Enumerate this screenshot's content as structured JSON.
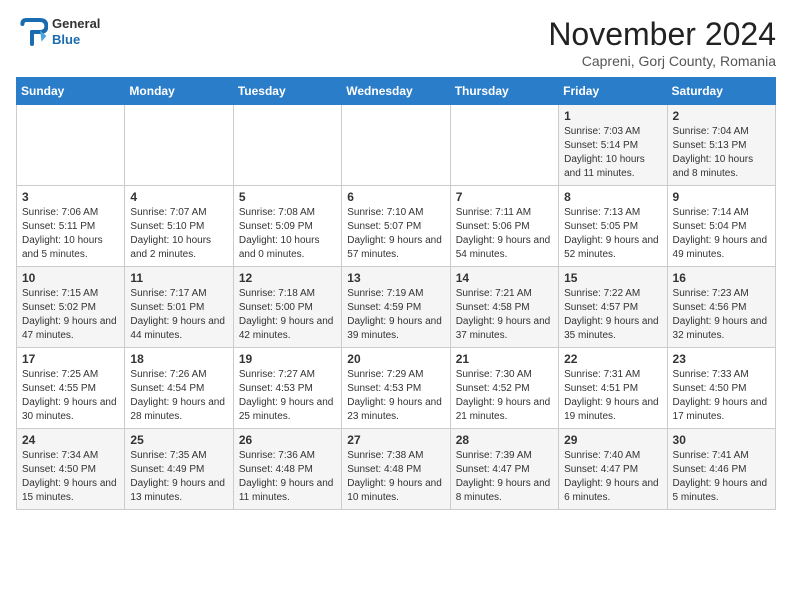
{
  "header": {
    "logo": {
      "general": "General",
      "blue": "Blue"
    },
    "month_title": "November 2024",
    "location": "Capreni, Gorj County, Romania"
  },
  "weekdays": [
    "Sunday",
    "Monday",
    "Tuesday",
    "Wednesday",
    "Thursday",
    "Friday",
    "Saturday"
  ],
  "weeks": [
    [
      {
        "day": "",
        "info": ""
      },
      {
        "day": "",
        "info": ""
      },
      {
        "day": "",
        "info": ""
      },
      {
        "day": "",
        "info": ""
      },
      {
        "day": "",
        "info": ""
      },
      {
        "day": "1",
        "info": "Sunrise: 7:03 AM\nSunset: 5:14 PM\nDaylight: 10 hours and 11 minutes."
      },
      {
        "day": "2",
        "info": "Sunrise: 7:04 AM\nSunset: 5:13 PM\nDaylight: 10 hours and 8 minutes."
      }
    ],
    [
      {
        "day": "3",
        "info": "Sunrise: 7:06 AM\nSunset: 5:11 PM\nDaylight: 10 hours and 5 minutes."
      },
      {
        "day": "4",
        "info": "Sunrise: 7:07 AM\nSunset: 5:10 PM\nDaylight: 10 hours and 2 minutes."
      },
      {
        "day": "5",
        "info": "Sunrise: 7:08 AM\nSunset: 5:09 PM\nDaylight: 10 hours and 0 minutes."
      },
      {
        "day": "6",
        "info": "Sunrise: 7:10 AM\nSunset: 5:07 PM\nDaylight: 9 hours and 57 minutes."
      },
      {
        "day": "7",
        "info": "Sunrise: 7:11 AM\nSunset: 5:06 PM\nDaylight: 9 hours and 54 minutes."
      },
      {
        "day": "8",
        "info": "Sunrise: 7:13 AM\nSunset: 5:05 PM\nDaylight: 9 hours and 52 minutes."
      },
      {
        "day": "9",
        "info": "Sunrise: 7:14 AM\nSunset: 5:04 PM\nDaylight: 9 hours and 49 minutes."
      }
    ],
    [
      {
        "day": "10",
        "info": "Sunrise: 7:15 AM\nSunset: 5:02 PM\nDaylight: 9 hours and 47 minutes."
      },
      {
        "day": "11",
        "info": "Sunrise: 7:17 AM\nSunset: 5:01 PM\nDaylight: 9 hours and 44 minutes."
      },
      {
        "day": "12",
        "info": "Sunrise: 7:18 AM\nSunset: 5:00 PM\nDaylight: 9 hours and 42 minutes."
      },
      {
        "day": "13",
        "info": "Sunrise: 7:19 AM\nSunset: 4:59 PM\nDaylight: 9 hours and 39 minutes."
      },
      {
        "day": "14",
        "info": "Sunrise: 7:21 AM\nSunset: 4:58 PM\nDaylight: 9 hours and 37 minutes."
      },
      {
        "day": "15",
        "info": "Sunrise: 7:22 AM\nSunset: 4:57 PM\nDaylight: 9 hours and 35 minutes."
      },
      {
        "day": "16",
        "info": "Sunrise: 7:23 AM\nSunset: 4:56 PM\nDaylight: 9 hours and 32 minutes."
      }
    ],
    [
      {
        "day": "17",
        "info": "Sunrise: 7:25 AM\nSunset: 4:55 PM\nDaylight: 9 hours and 30 minutes."
      },
      {
        "day": "18",
        "info": "Sunrise: 7:26 AM\nSunset: 4:54 PM\nDaylight: 9 hours and 28 minutes."
      },
      {
        "day": "19",
        "info": "Sunrise: 7:27 AM\nSunset: 4:53 PM\nDaylight: 9 hours and 25 minutes."
      },
      {
        "day": "20",
        "info": "Sunrise: 7:29 AM\nSunset: 4:53 PM\nDaylight: 9 hours and 23 minutes."
      },
      {
        "day": "21",
        "info": "Sunrise: 7:30 AM\nSunset: 4:52 PM\nDaylight: 9 hours and 21 minutes."
      },
      {
        "day": "22",
        "info": "Sunrise: 7:31 AM\nSunset: 4:51 PM\nDaylight: 9 hours and 19 minutes."
      },
      {
        "day": "23",
        "info": "Sunrise: 7:33 AM\nSunset: 4:50 PM\nDaylight: 9 hours and 17 minutes."
      }
    ],
    [
      {
        "day": "24",
        "info": "Sunrise: 7:34 AM\nSunset: 4:50 PM\nDaylight: 9 hours and 15 minutes."
      },
      {
        "day": "25",
        "info": "Sunrise: 7:35 AM\nSunset: 4:49 PM\nDaylight: 9 hours and 13 minutes."
      },
      {
        "day": "26",
        "info": "Sunrise: 7:36 AM\nSunset: 4:48 PM\nDaylight: 9 hours and 11 minutes."
      },
      {
        "day": "27",
        "info": "Sunrise: 7:38 AM\nSunset: 4:48 PM\nDaylight: 9 hours and 10 minutes."
      },
      {
        "day": "28",
        "info": "Sunrise: 7:39 AM\nSunset: 4:47 PM\nDaylight: 9 hours and 8 minutes."
      },
      {
        "day": "29",
        "info": "Sunrise: 7:40 AM\nSunset: 4:47 PM\nDaylight: 9 hours and 6 minutes."
      },
      {
        "day": "30",
        "info": "Sunrise: 7:41 AM\nSunset: 4:46 PM\nDaylight: 9 hours and 5 minutes."
      }
    ]
  ]
}
